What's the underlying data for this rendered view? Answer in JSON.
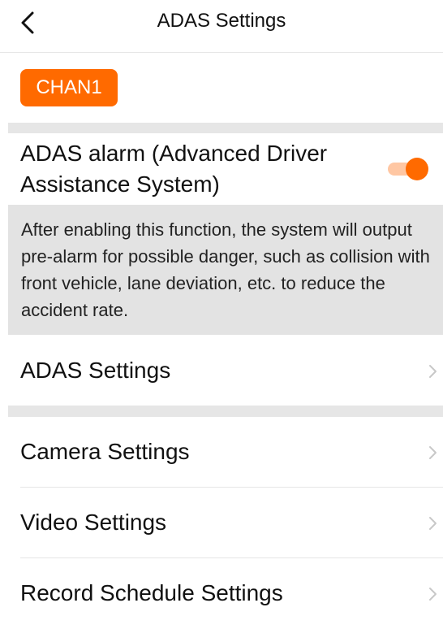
{
  "header": {
    "title": "ADAS Settings",
    "back_icon": "chevron-left-icon"
  },
  "channel": {
    "label": "CHAN1",
    "color": "#ff6a00"
  },
  "adas_alarm": {
    "label": "ADAS alarm (Advanced Driver Assistance System)",
    "enabled": true,
    "description": "After enabling this function, the system will output pre-alarm for possible danger, such as collision with front vehicle, lane deviation, etc. to reduce the accident rate."
  },
  "menu": {
    "adas_settings": "ADAS Settings",
    "camera_settings": "Camera Settings",
    "video_settings": "Video Settings",
    "record_schedule_settings": "Record Schedule Settings"
  }
}
